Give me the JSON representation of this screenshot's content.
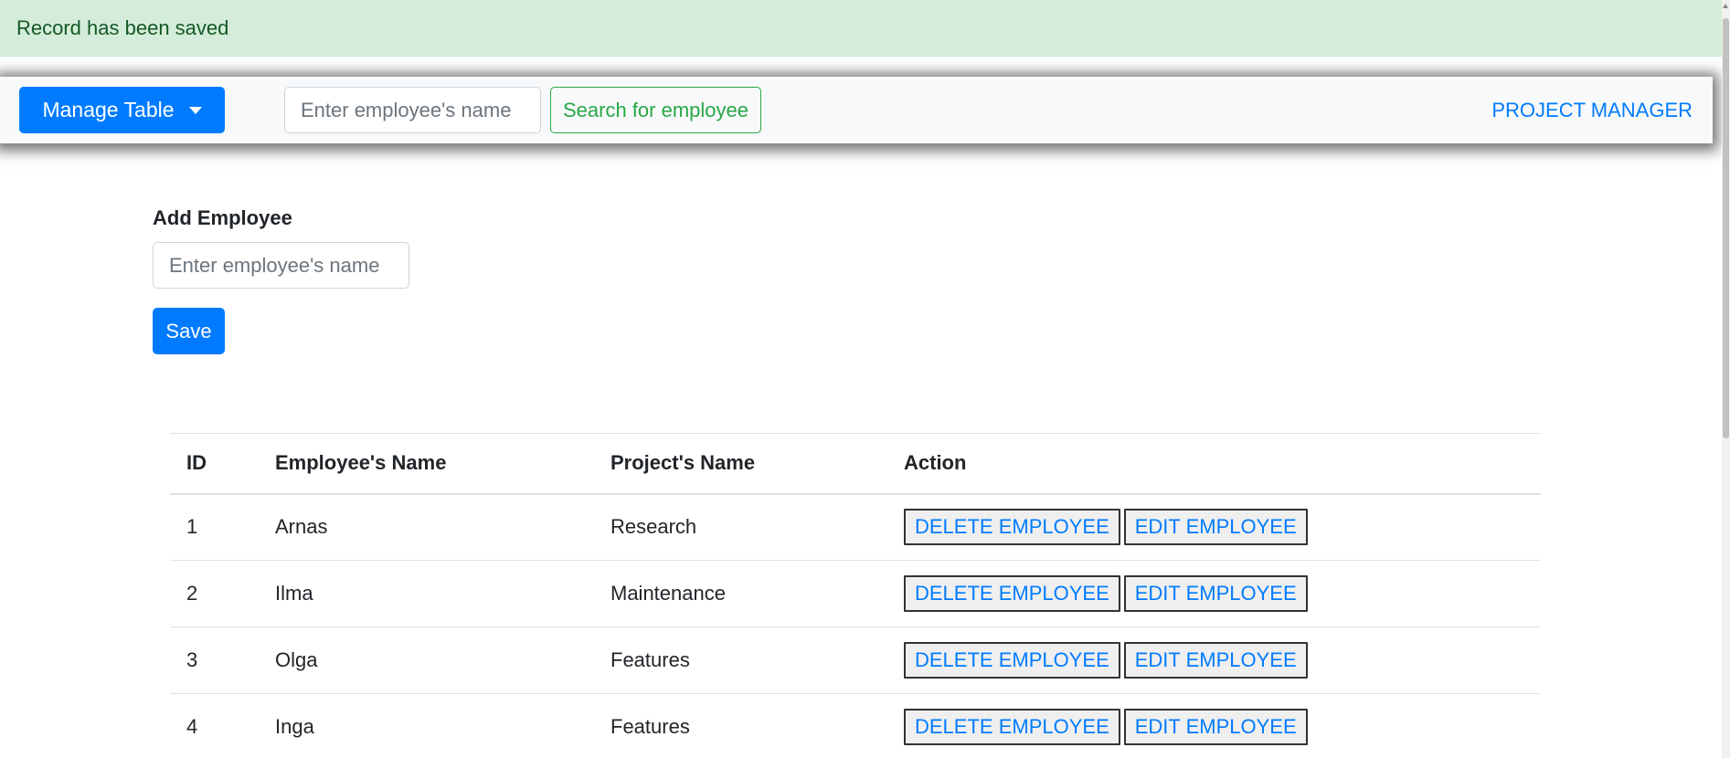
{
  "alert": {
    "message": "Record has been saved"
  },
  "navbar": {
    "manage_label": "Manage Table",
    "search_placeholder": "Enter employee's name",
    "search_button": "Search for employee",
    "brand": "PROJECT MANAGER"
  },
  "form": {
    "title": "Add Employee",
    "input_placeholder": "Enter employee's name",
    "save_label": "Save"
  },
  "table": {
    "headers": [
      "ID",
      "Employee's Name",
      "Project's Name",
      "Action"
    ],
    "rows": [
      {
        "id": "1",
        "name": "Arnas",
        "project": "Research",
        "delete_label": "DELETE EMPLOYEE",
        "edit_label": "EDIT EMPLOYEE"
      },
      {
        "id": "2",
        "name": "Ilma",
        "project": "Maintenance",
        "delete_label": "DELETE EMPLOYEE",
        "edit_label": "EDIT EMPLOYEE"
      },
      {
        "id": "3",
        "name": "Olga",
        "project": "Features",
        "delete_label": "DELETE EMPLOYEE",
        "edit_label": "EDIT EMPLOYEE"
      },
      {
        "id": "4",
        "name": "Inga",
        "project": "Features",
        "delete_label": "DELETE EMPLOYEE",
        "edit_label": "EDIT EMPLOYEE"
      }
    ]
  },
  "colors": {
    "primary": "#007bff",
    "success": "#28a745",
    "alert_bg": "#d4edda",
    "alert_text": "#155724"
  }
}
